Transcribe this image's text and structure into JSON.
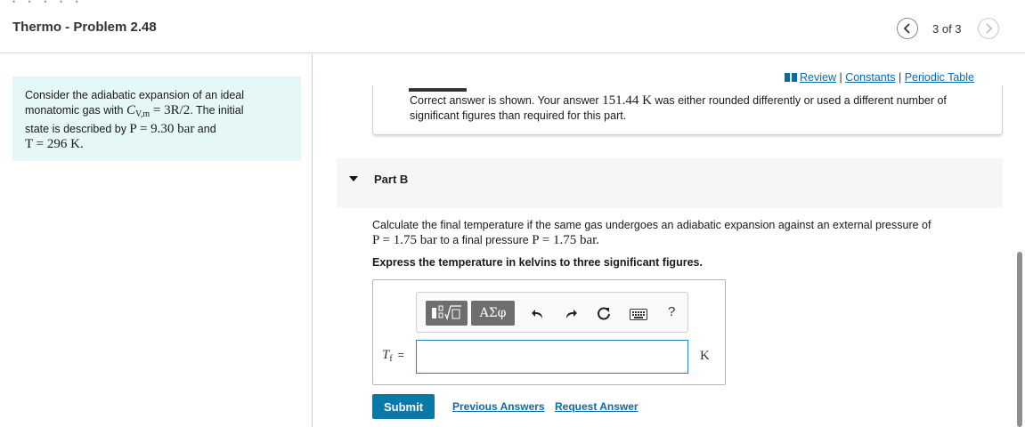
{
  "header": {
    "title": "Thermo - Problem 2.48",
    "page_count": "3 of 3",
    "prev_icon": "chevron-left-icon",
    "next_icon": "chevron-right-icon"
  },
  "problem": {
    "line1": "Consider the adiabatic expansion of an ideal",
    "line2_a": "monatomic gas with ",
    "cv_symbol": "C",
    "cv_sub": "V,m",
    "line2_b": " = 3R/2",
    "line2_c": ". The initial",
    "line3_a": "state is described by ",
    "line3_math": "P = 9.30 bar",
    "line3_b": " and",
    "line4_math": "T = 296 K."
  },
  "review_links": {
    "review": "Review",
    "separator": " | ",
    "constants": "Constants",
    "periodic_table": "Periodic Table"
  },
  "feedback": {
    "line1_a": "Correct answer is shown. Your answer ",
    "line1_math": "151.44 K",
    "line1_b": " was either rounded differently or used a different number of",
    "line2": "significant figures than required for this part."
  },
  "part_b": {
    "label": "Part B",
    "question_line1": "Calculate the final temperature if the same gas undergoes an adiabatic expansion against an external pressure of",
    "question_math1": "P = 1.75 bar",
    "question_mid": " to a final pressure ",
    "question_math2": "P = 1.75 bar.",
    "instruction": "Express the temperature in kelvins to three significant figures."
  },
  "toolbar": {
    "symbols_label": "ΑΣφ",
    "help_label": "?",
    "icons": [
      "templates-icon",
      "undo-icon",
      "redo-icon",
      "reset-icon",
      "keyboard-icon",
      "help-icon"
    ]
  },
  "answer": {
    "var_symbol": "T",
    "var_sub": "f",
    "equals": "=",
    "value": "",
    "unit": "K"
  },
  "actions": {
    "submit": "Submit",
    "previous_answers": "Previous Answers",
    "request_answer": "Request Answer"
  },
  "colors": {
    "problem_bg": "#e6f7f8",
    "accent": "#0b79a8",
    "link": "#0b6aa8"
  }
}
